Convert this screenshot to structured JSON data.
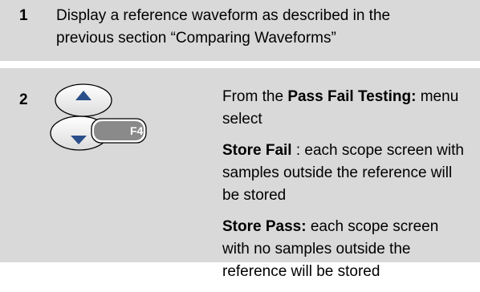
{
  "step1": {
    "number": "1",
    "lines": [
      "Display a reference waveform as described in the",
      "previous section “Comparing Waveforms”"
    ]
  },
  "step2": {
    "number": "2",
    "key_label": "F4",
    "intro": {
      "prefix": "From the ",
      "bold": "Pass Fail Testing:",
      "suffix": " menu",
      "line2": "select"
    },
    "store_fail": {
      "bold": "Store Fail",
      "line1_rest": " : each scope screen with",
      "line2": "samples outside the reference will",
      "line3": "be stored"
    },
    "store_pass": {
      "bold": "Store Pass:",
      "line1_rest": " each scope screen",
      "line2": "with no samples outside the",
      "line3": "reference will be stored"
    }
  },
  "colors": {
    "row_bg": "#d9d9d9",
    "key_face": "#8a8a8a",
    "key_label": "#ffffff"
  }
}
